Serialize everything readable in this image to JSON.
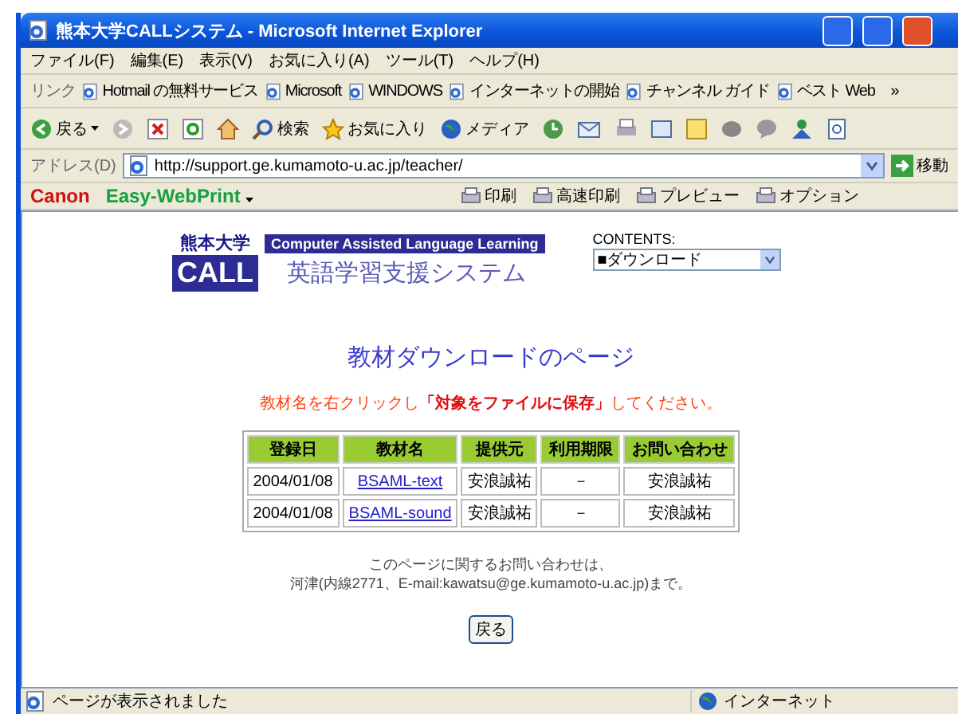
{
  "window": {
    "title": "熊本大学CALLシステム - Microsoft Internet Explorer"
  },
  "menu": [
    "ファイル(F)",
    "編集(E)",
    "表示(V)",
    "お気に入り(A)",
    "ツール(T)",
    "ヘルプ(H)"
  ],
  "links_bar": {
    "label": "リンク",
    "items": [
      "Hotmail の無料サービス",
      "Microsoft",
      "WINDOWS",
      "インターネットの開始",
      "チャンネル ガイド",
      "ベスト Web"
    ],
    "more": "»"
  },
  "toolbar": {
    "back": "戻る",
    "search": "検索",
    "favorites": "お気に入り",
    "media": "メディア"
  },
  "address_bar": {
    "label": "アドレス(D)",
    "value": "http://support.ge.kumamoto-u.ac.jp/teacher/",
    "go": "移動"
  },
  "print_bar": {
    "brand": "Canon",
    "product": "Easy-WebPrint",
    "buttons": [
      "印刷",
      "高速印刷",
      "プレビュー",
      "オプション"
    ]
  },
  "page": {
    "logo": {
      "university": "熊本大学",
      "tagline": "Computer Assisted Language Learning",
      "acronym": "CALL",
      "system_name": "英語学習支援システム"
    },
    "contents": {
      "label": "CONTENTS:",
      "value": "■ダウンロード"
    },
    "heading": "教材ダウンロードのページ",
    "instruction": "教材名を右クリックし**「対象をファイルに保存」**してください。",
    "table": {
      "columns": [
        "登録日",
        "教材名",
        "提供元",
        "利用期限",
        "お問い合わせ"
      ],
      "rows": [
        {
          "cells": [
            "2004/01/08",
            "BSAML-text",
            "安浪誠祐",
            "－",
            "安浪誠祐"
          ]
        },
        {
          "cells": [
            "2004/01/08",
            "BSAML-sound",
            "安浪誠祐",
            "－",
            "安浪誠祐"
          ]
        }
      ]
    },
    "contact": [
      "このページに関するお問い合わせは、",
      "河津(内線2771、E-mail:kawatsu@ge.kumamoto-u.ac.jp)まで。"
    ],
    "back_button": "戻る"
  },
  "status_bar": {
    "text": "ページが表示されました",
    "zone": "インターネット"
  }
}
